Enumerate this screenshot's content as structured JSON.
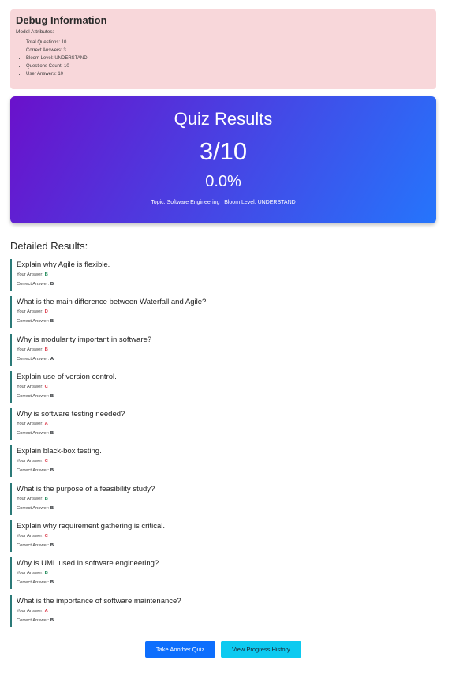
{
  "debug": {
    "title": "Debug Information",
    "subtitle": "Model Attributes:",
    "items": [
      "Total Questions: 10",
      "Correct Answers: 3",
      "Bloom Level: UNDERSTAND",
      "Questions Count: 10",
      "User Answers: 10"
    ]
  },
  "results_header": {
    "title": "Quiz Results",
    "score": "3/10",
    "percent": "0.0%",
    "topic_label": "Topic: Software Engineering",
    "separator": " | ",
    "bloom_label": "Bloom Level: UNDERSTAND"
  },
  "detailed": {
    "title": "Detailed Results:",
    "your_answer_label": "Your Answer: ",
    "correct_answer_label": "Correct Answer: ",
    "questions": [
      {
        "text": "Explain why Agile is flexible.",
        "your": "B",
        "correct": "B"
      },
      {
        "text": "What is the main difference between Waterfall and Agile?",
        "your": "D",
        "correct": "B"
      },
      {
        "text": "Why is modularity important in software?",
        "your": "B",
        "correct": "A"
      },
      {
        "text": "Explain use of version control.",
        "your": "C",
        "correct": "B"
      },
      {
        "text": "Why is software testing needed?",
        "your": "A",
        "correct": "B"
      },
      {
        "text": "Explain black-box testing.",
        "your": "C",
        "correct": "B"
      },
      {
        "text": "What is the purpose of a feasibility study?",
        "your": "B",
        "correct": "B"
      },
      {
        "text": "Explain why requirement gathering is critical.",
        "your": "C",
        "correct": "B"
      },
      {
        "text": "Why is UML used in software engineering?",
        "your": "B",
        "correct": "B"
      },
      {
        "text": "What is the importance of software maintenance?",
        "your": "A",
        "correct": "B"
      }
    ]
  },
  "actions": {
    "take_another": "Take Another Quiz",
    "view_history": "View Progress History"
  },
  "colors": {
    "correct": "#198754",
    "wrong": "#dc3545",
    "primary": "#0d6efd",
    "info": "#0dcaf0"
  }
}
